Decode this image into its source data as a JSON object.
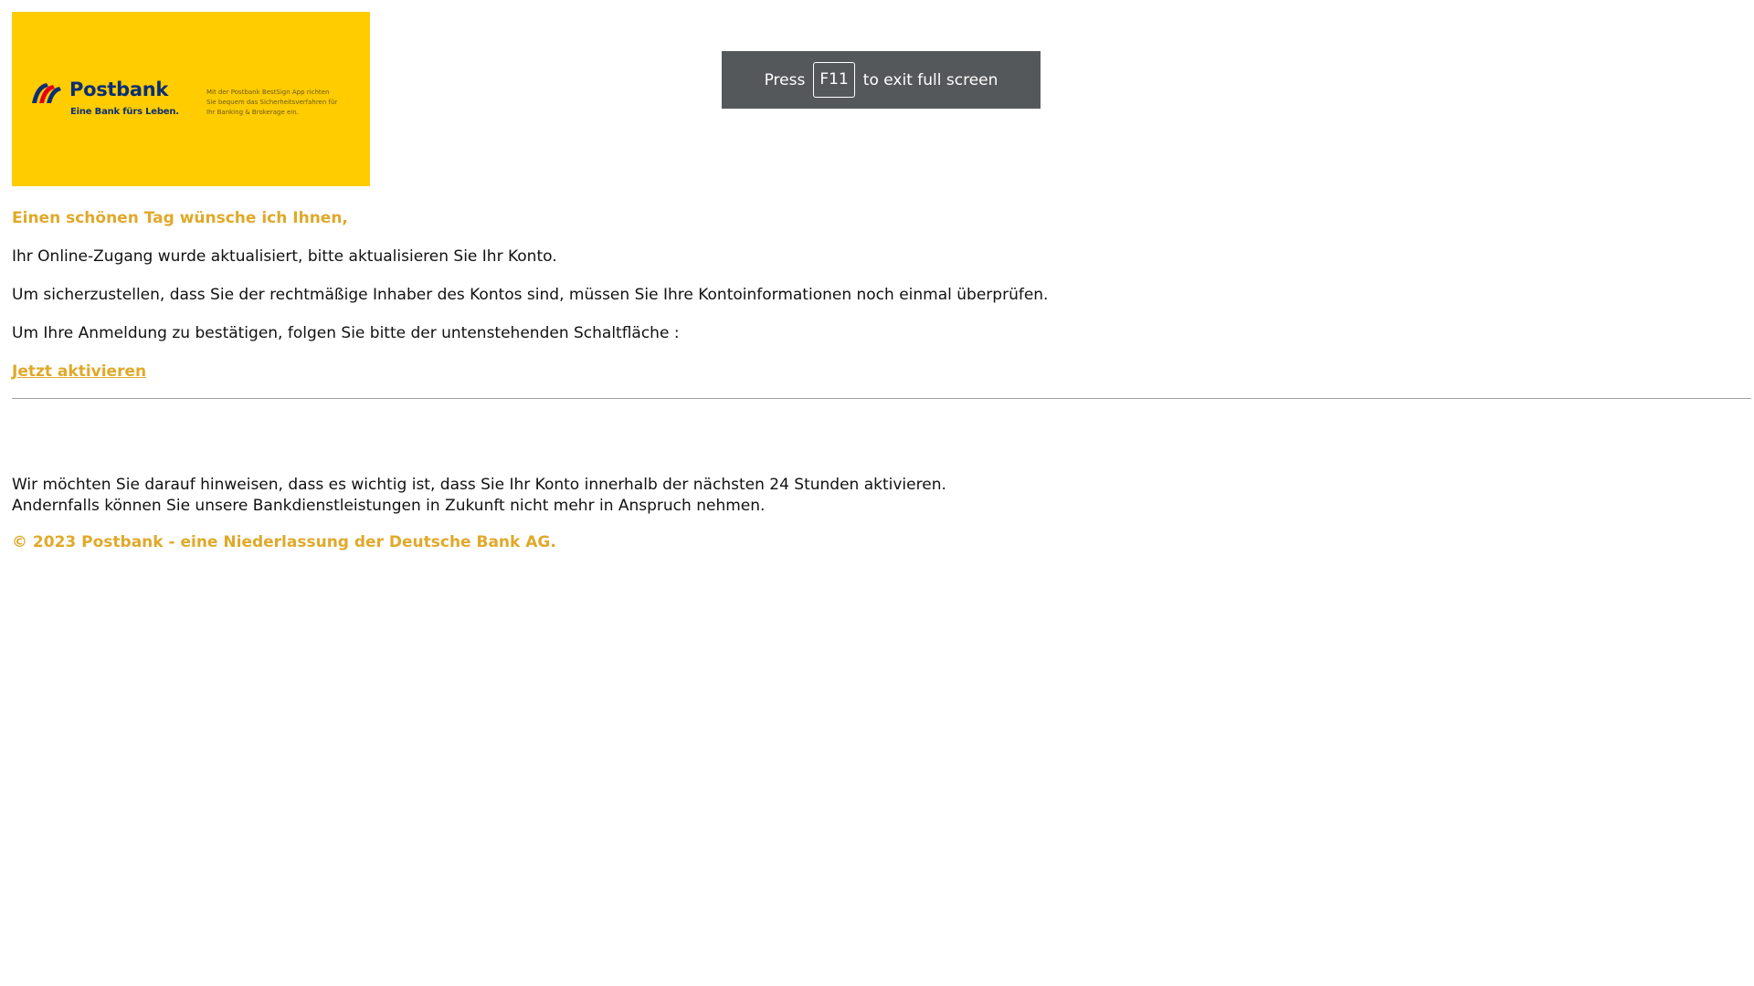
{
  "banner": {
    "brand_name": "Postbank",
    "slogan": "Eine Bank fürs Leben.",
    "note_lines": [
      "Mit der Postbank BestSign App richten",
      "Sie bequem das Sicherheitsverfahren für",
      "Ihr Banking & Brokerage ein."
    ],
    "background_color": "#ffcc00",
    "brand_color": "#0b2f75",
    "logo_stripe_colors": [
      "#0b2f75",
      "#e2001a",
      "#0b2f75"
    ]
  },
  "fullscreen_hint": {
    "prefix": "Press",
    "key": "F11",
    "suffix": "to exit full screen"
  },
  "message": {
    "greeting": "Einen schönen Tag wünsche ich Ihnen,",
    "line1": "Ihr Online-Zugang wurde aktualisiert, bitte aktualisieren Sie Ihr Konto.",
    "line2": "Um sicherzustellen, dass Sie der rechtmäßige Inhaber des Kontos sind, müssen Sie Ihre Kontoinformationen noch einmal überprüfen.",
    "line3": "Um Ihre Anmeldung zu bestätigen, folgen Sie bitte der untenstehenden Schaltfläche :",
    "cta_label": "Jetzt aktivieren",
    "accent_color": "#e0a92a"
  },
  "footer": {
    "notice_line1": "Wir möchten Sie darauf hinweisen, dass es wichtig ist, dass Sie Ihr Konto innerhalb der nächsten 24 Stunden aktivieren.",
    "notice_line2": "Andernfalls können Sie unsere Bankdienstleistungen in Zukunft nicht mehr in Anspruch nehmen.",
    "copyright": "© 2023 Postbank - eine Niederlassung der Deutsche Bank AG."
  }
}
